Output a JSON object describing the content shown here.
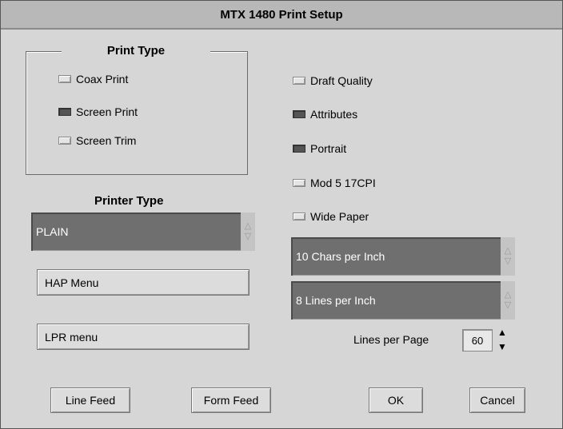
{
  "window": {
    "title": "MTX 1480 Print Setup"
  },
  "print_type": {
    "label": "Print Type",
    "options": [
      {
        "label": "Coax Print",
        "checked": false
      },
      {
        "label": "Screen Print",
        "checked": true
      },
      {
        "label": "Screen Trim",
        "checked": false
      }
    ]
  },
  "printer_type": {
    "label": "Printer Type",
    "value": "PLAIN"
  },
  "menus": {
    "hap": "HAP Menu",
    "lpr": "LPR menu"
  },
  "options": [
    {
      "label": "Draft Quality",
      "checked": false
    },
    {
      "label": "Attributes",
      "checked": true
    },
    {
      "label": "Portrait",
      "checked": true
    },
    {
      "label": "Mod 5 17CPI",
      "checked": false
    },
    {
      "label": "Wide Paper",
      "checked": false
    }
  ],
  "chars_per_inch": "10 Chars per Inch",
  "lines_per_inch": "8 Lines per Inch",
  "lines_per_page": {
    "label": "Lines per Page",
    "value": "60"
  },
  "buttons": {
    "line_feed": "Line Feed",
    "form_feed": "Form Feed",
    "ok": "OK",
    "cancel": "Cancel"
  }
}
